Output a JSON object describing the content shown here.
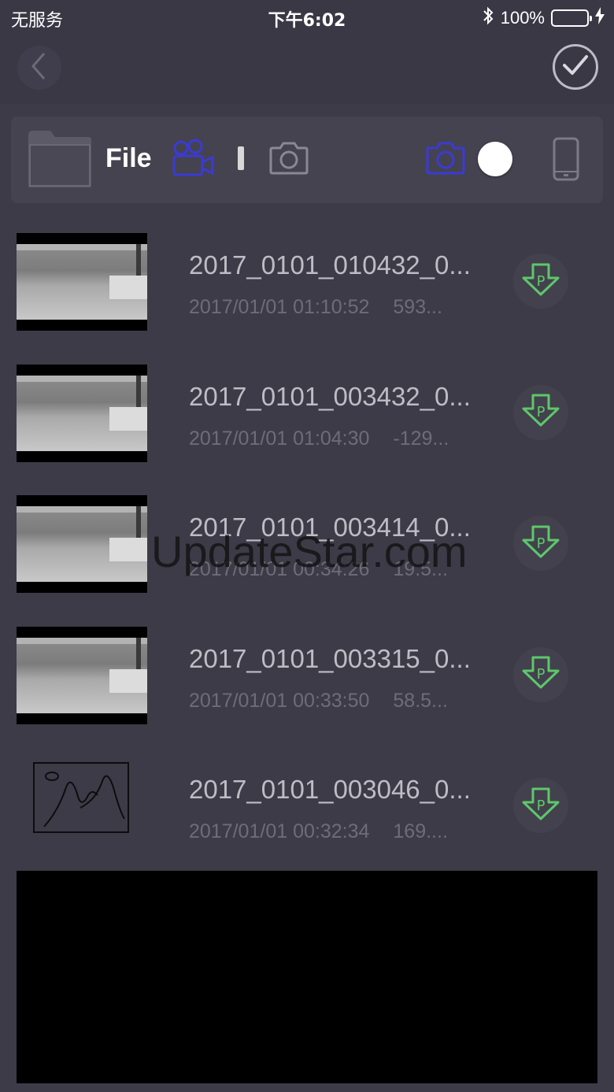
{
  "status_bar": {
    "carrier": "无服务",
    "time": "下午6:02",
    "battery": "100%"
  },
  "toolbar": {
    "file_label": "File"
  },
  "colors": {
    "background": "#3d3b48",
    "accent_blue": "#3b3ad6",
    "download_green": "#5ec76b",
    "battery_green": "#4cd964"
  },
  "files": [
    {
      "name": "2017_0101_010432_0...",
      "date": "2017/01/01 01:10:52",
      "size": "593...",
      "thumb": "camera"
    },
    {
      "name": "2017_0101_003432_0...",
      "date": "2017/01/01 01:04:30",
      "size": "-129...",
      "thumb": "camera"
    },
    {
      "name": "2017_0101_003414_0...",
      "date": "2017/01/01 00:34:26",
      "size": "19.5...",
      "thumb": "camera"
    },
    {
      "name": "2017_0101_003315_0...",
      "date": "2017/01/01 00:33:50",
      "size": "58.5...",
      "thumb": "camera"
    },
    {
      "name": "2017_0101_003046_0...",
      "date": "2017/01/01 00:32:34",
      "size": "169....",
      "thumb": "sketch"
    }
  ],
  "watermark": "UpdateStar.com",
  "icons": {
    "back": "chevron-left-icon",
    "confirm": "checkmark-icon",
    "folder": "folder-icon",
    "video": "video-camera-icon",
    "photo": "camera-icon",
    "phone": "phone-icon",
    "download": "download-p-icon"
  }
}
